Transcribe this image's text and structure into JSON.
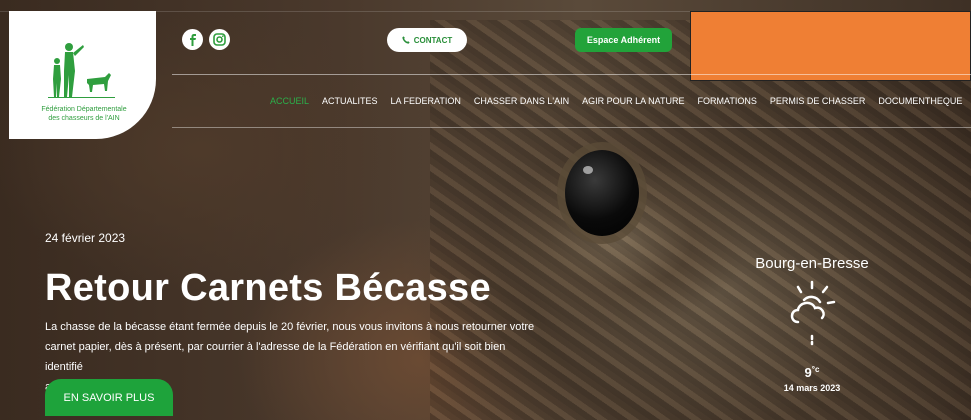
{
  "logo": {
    "org_line1": "Fédération Départementale",
    "org_line2": "des chasseurs de l'AIN",
    "brand_color": "#2f9e3e"
  },
  "header": {
    "social": [
      {
        "name": "facebook",
        "icon": "facebook-icon"
      },
      {
        "name": "instagram",
        "icon": "instagram-icon"
      }
    ],
    "contact_label": "CONTACT",
    "adherent_label": "Espace Adhérent",
    "accent": "#22a33a",
    "overlay_color": "#ef7f34"
  },
  "nav": {
    "items": [
      {
        "label": "ACCUEIL",
        "active": true
      },
      {
        "label": "ACTUALITES",
        "active": false
      },
      {
        "label": "LA FEDERATION",
        "active": false
      },
      {
        "label": "CHASSER DANS L'AIN",
        "active": false
      },
      {
        "label": "AGIR POUR LA NATURE",
        "active": false
      },
      {
        "label": "FORMATIONS",
        "active": false
      },
      {
        "label": "PERMIS DE CHASSER",
        "active": false
      },
      {
        "label": "DOCUMENTHEQUE",
        "active": false
      }
    ]
  },
  "hero": {
    "date": "24 février 2023",
    "title": "Retour Carnets Bécasse",
    "desc_line1": "La chasse de la bécasse étant fermée depuis le 20 février, nous vous invitons à nous retourner votre",
    "desc_line2": "carnet papier, dès à présent, par courrier à l'adresse de la Fédération en vérifiant qu'il soit bien identifié",
    "desc_line3": "avec vos nom et prénom.",
    "cta_label": "EN SAVOIR PLUS"
  },
  "weather": {
    "city": "Bourg-en-Bresse",
    "icon": "partly-sunny-icon",
    "temp": "9",
    "unit": "°c",
    "date": "14 mars 2023"
  }
}
